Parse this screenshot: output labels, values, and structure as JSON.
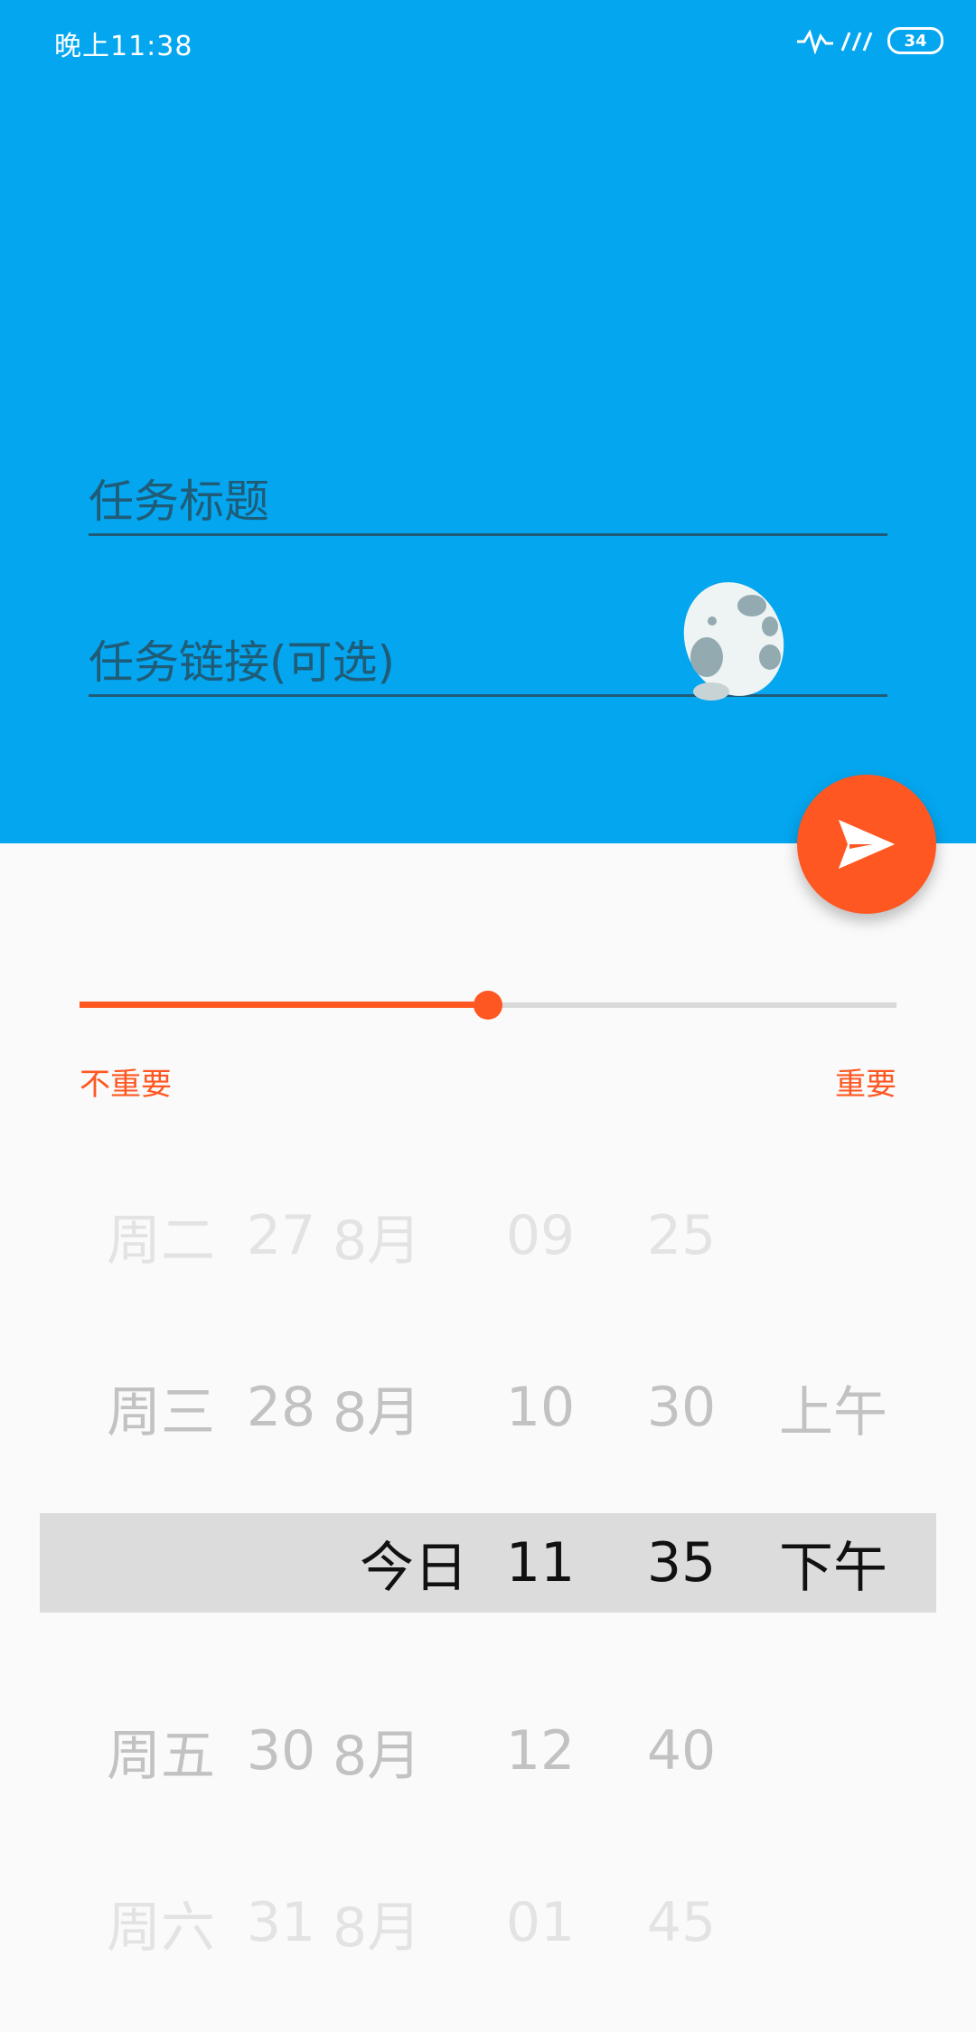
{
  "status_bar": {
    "time": "晚上11:38",
    "battery": "34"
  },
  "form": {
    "title_placeholder": "任务标题",
    "link_placeholder": "任务链接(可选)"
  },
  "importance": {
    "left_label": "不重要",
    "right_label": "重要",
    "value_fraction": 0.5
  },
  "picker": {
    "rows": [
      {
        "weekday": "周二",
        "day": "27",
        "month": "8月",
        "hour": "09",
        "minute": "25",
        "ampm": ""
      },
      {
        "weekday": "周三",
        "day": "28",
        "month": "8月",
        "hour": "10",
        "minute": "30",
        "ampm": "上午"
      },
      {
        "today": "今日",
        "hour": "11",
        "minute": "35",
        "ampm": "下午"
      },
      {
        "weekday": "周五",
        "day": "30",
        "month": "8月",
        "hour": "12",
        "minute": "40",
        "ampm": ""
      },
      {
        "weekday": "周六",
        "day": "31",
        "month": "8月",
        "hour": "01",
        "minute": "45",
        "ampm": ""
      }
    ]
  },
  "colors": {
    "primary": "#04a6ef",
    "accent": "#ff5722"
  }
}
